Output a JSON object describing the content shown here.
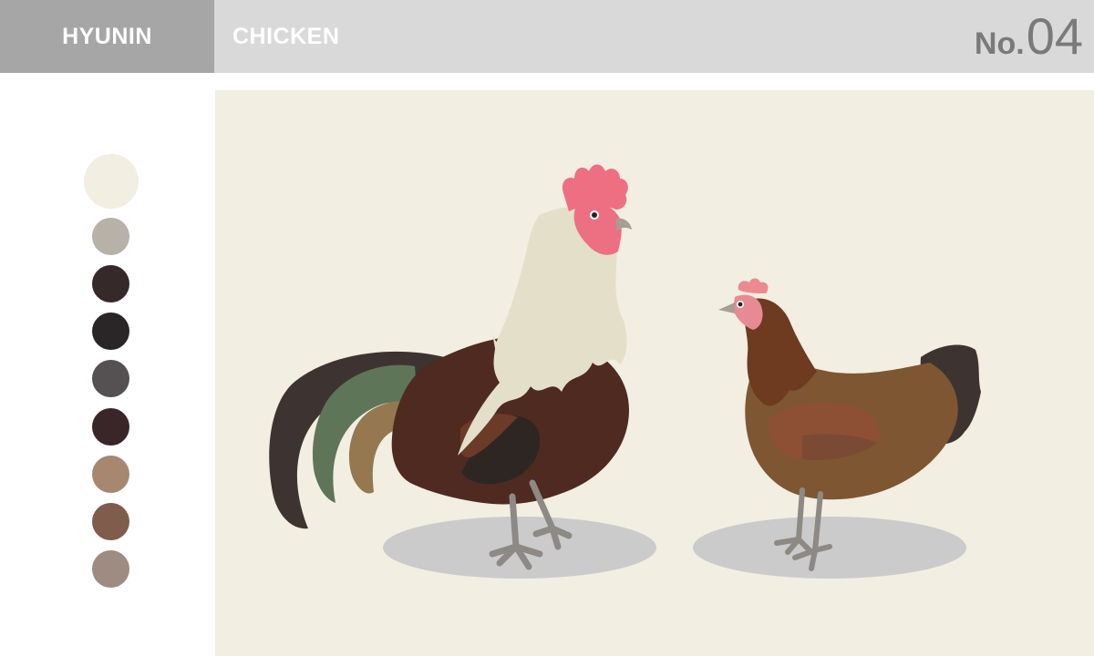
{
  "header": {
    "author": "HYUNIN",
    "subject": "CHICKEN",
    "number_prefix": "No.",
    "number": "04"
  },
  "palette": {
    "colors": [
      "#f2eee1",
      "#b8b1a7",
      "#35292a",
      "#2a2627",
      "#555152",
      "#3a2628",
      "#a78770",
      "#7f5c4c",
      "#9e8b82"
    ]
  },
  "illustration": {
    "subjects": [
      "rooster",
      "hen"
    ]
  }
}
